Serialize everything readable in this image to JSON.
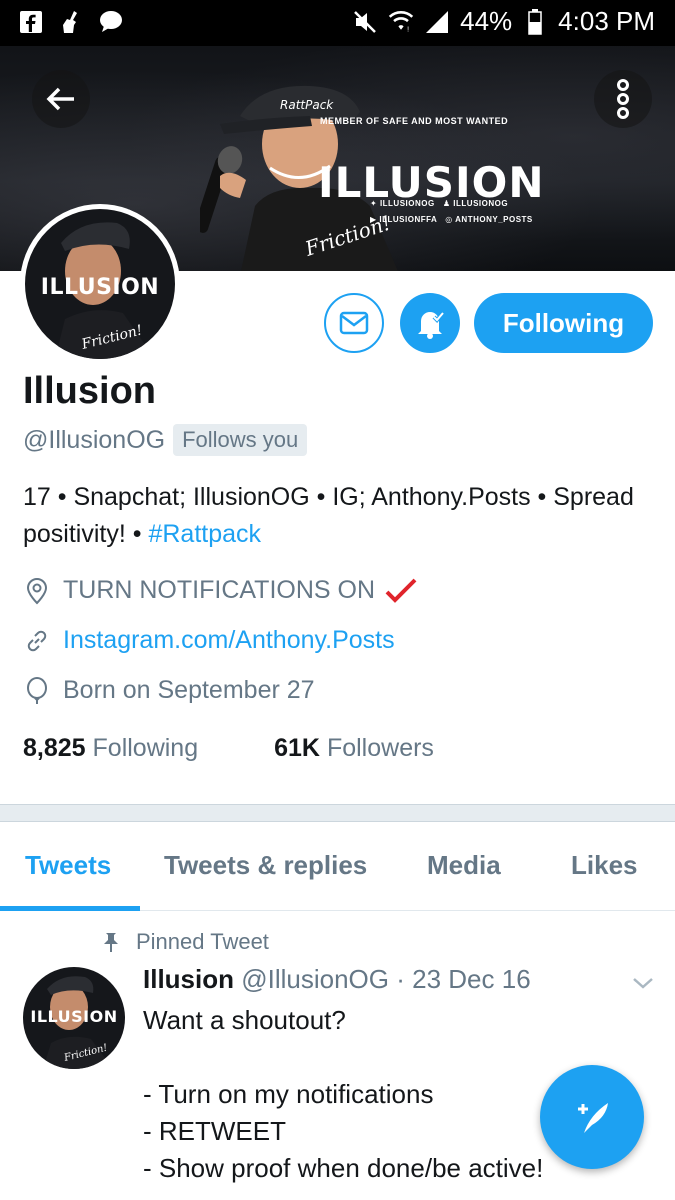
{
  "status_bar": {
    "battery": "44%",
    "time": "4:03 PM",
    "icons": [
      "facebook-icon",
      "broom-icon",
      "chat-bubble-icon",
      "mute-icon",
      "wifi-icon",
      "signal-icon",
      "battery-icon"
    ]
  },
  "banner": {
    "subtitle": "MEMBER OF SAFE AND MOST WANTED",
    "title": "ILLUSION",
    "handles": [
      "ILLUSIONOG",
      "ILLUSIONOG",
      "ILLUSIONFFA",
      "ANTHONY_POSTS"
    ],
    "cap_text": "RattPack",
    "shirt_text": "Friction!"
  },
  "avatar": {
    "text": "ILLUSION"
  },
  "actions": {
    "following_label": "Following"
  },
  "profile": {
    "name": "Illusion",
    "handle": "@IllusionOG",
    "follows_you": "Follows you",
    "bio_text": "17 • Snapchat; IllusionOG • IG; Anthony.Posts • Spread positivity! • ",
    "bio_hashtag": "#Rattpack",
    "location": "TURN NOTIFICATIONS ON",
    "website": "Instagram.com/Anthony.Posts",
    "birthday": "Born on September 27",
    "following_count": "8,825",
    "following_label": "Following",
    "followers_count": "61K",
    "followers_label": "Followers"
  },
  "tabs": [
    {
      "label": "Tweets",
      "active": true
    },
    {
      "label": "Tweets & replies",
      "active": false
    },
    {
      "label": "Media",
      "active": false
    },
    {
      "label": "Likes",
      "active": false
    }
  ],
  "pinned_tweet": {
    "pinned_label": "Pinned Tweet",
    "name": "Illusion",
    "handle": "@IllusionOG",
    "date": "· 23 Dec 16",
    "body": "Want a shoutout?\n\n- Turn on my notifications\n- RETWEET\n- Show proof when done/be active!",
    "avatar_text": "ILLUSION"
  },
  "colors": {
    "accent": "#1da1f2",
    "muted": "#657786",
    "text": "#14171a",
    "check": "#e0242b"
  }
}
